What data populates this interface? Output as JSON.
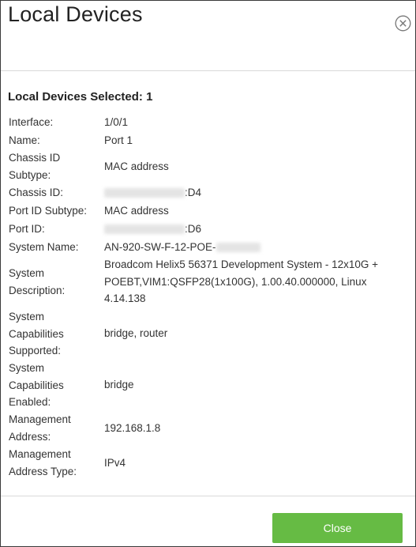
{
  "dialog": {
    "title": "Local Devices",
    "close_icon": "close-circle-icon"
  },
  "section": {
    "title": "Local Devices Selected: 1"
  },
  "details": {
    "interface": {
      "label": "Interface:",
      "value": "1/0/1"
    },
    "name": {
      "label": "Name:",
      "value": "Port 1"
    },
    "chassis_id_subtype": {
      "label": "Chassis ID Subtype:",
      "value": "MAC address"
    },
    "chassis_id": {
      "label": "Chassis ID:",
      "value_suffix": ":D4"
    },
    "port_id_subtype": {
      "label": "Port ID Subtype:",
      "value": "MAC address"
    },
    "port_id": {
      "label": "Port ID:",
      "value_suffix": ":D6"
    },
    "system_name": {
      "label": "System Name:",
      "value_prefix": "AN-920-SW-F-12-POE-"
    },
    "system_description": {
      "label": "System Description:",
      "value": "Broadcom Helix5 56371 Development System - 12x10G + POEBT,VIM1:QSFP28(1x100G), 1.00.40.000000, Linux 4.14.138"
    },
    "capabilities_supported": {
      "label": "System Capabilities Supported:",
      "value": "bridge, router"
    },
    "capabilities_enabled": {
      "label": "System Capabilities Enabled:",
      "value": "bridge"
    },
    "management_address": {
      "label": "Management Address:",
      "value": "192.168.1.8"
    },
    "management_address_type": {
      "label": "Management Address Type:",
      "value": "IPv4"
    }
  },
  "footer": {
    "close_label": "Close"
  },
  "colors": {
    "accent": "#66bb44",
    "divider": "#d9d9d9",
    "text": "#333333"
  }
}
